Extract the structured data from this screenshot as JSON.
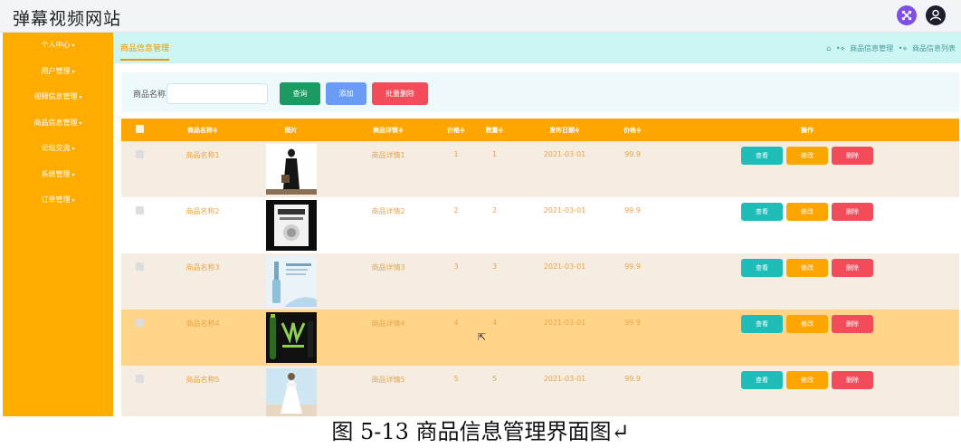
{
  "header": {
    "site_title": "弹幕视频网站",
    "fullscreen_icon": "fullscreen-icon",
    "user_icon": "user-avatar-icon"
  },
  "sidebar": {
    "items": [
      {
        "label": "个人中心"
      },
      {
        "label": "用户管理"
      },
      {
        "label": "视频信息管理"
      },
      {
        "label": "商品信息管理"
      },
      {
        "label": "论坛交流"
      },
      {
        "label": "系统管理"
      },
      {
        "label": "订单管理"
      }
    ]
  },
  "tabbar": {
    "active_tab": "商品信息管理",
    "breadcrumb": [
      "商品信息管理",
      "商品信息列表"
    ]
  },
  "search": {
    "label": "商品名称",
    "value": "",
    "placeholder": "",
    "query_label": "查询",
    "add_label": "添加",
    "batch_delete_label": "批量删除"
  },
  "table": {
    "columns": [
      "商品名称",
      "图片",
      "商品详情",
      "价格",
      "数量",
      "发布日期",
      "价格",
      "操作"
    ],
    "sort_marker": "≑",
    "rows": [
      {
        "name": "商品名称1",
        "image": "woman-black-coat-photo",
        "detail": "商品详情1",
        "price": "1",
        "qty": "1",
        "date": "2021-03-01",
        "price2": "99.9"
      },
      {
        "name": "商品名称2",
        "image": "book-cover-photo",
        "detail": "商品详情2",
        "price": "2",
        "qty": "2",
        "date": "2021-03-01",
        "price2": "99.9"
      },
      {
        "name": "商品名称3",
        "image": "serum-bottle-photo",
        "detail": "商品详情3",
        "price": "3",
        "qty": "3",
        "date": "2021-03-01",
        "price2": "99.9"
      },
      {
        "name": "商品名称4",
        "image": "energy-drink-photo",
        "detail": "商品详情4",
        "price": "4",
        "qty": "4",
        "date": "2021-03-01",
        "price2": "99.9"
      },
      {
        "name": "商品名称5",
        "image": "woman-white-dress-photo",
        "detail": "商品详情5",
        "price": "5",
        "qty": "5",
        "date": "2021-03-01",
        "price2": "99.9"
      }
    ],
    "actions": {
      "view": "查看",
      "edit": "修改",
      "delete": "删除"
    }
  },
  "caption": "图 5-13 商品信息管理界面图↵",
  "colors": {
    "sidebar": "#ffac00",
    "table_header": "#ffa500",
    "tabbar": "#cdf5f4",
    "btn_query": "#1b9a62",
    "btn_add": "#6a9bf5",
    "btn_delete": "#f24c5b",
    "btn_view": "#1fbcb8"
  }
}
